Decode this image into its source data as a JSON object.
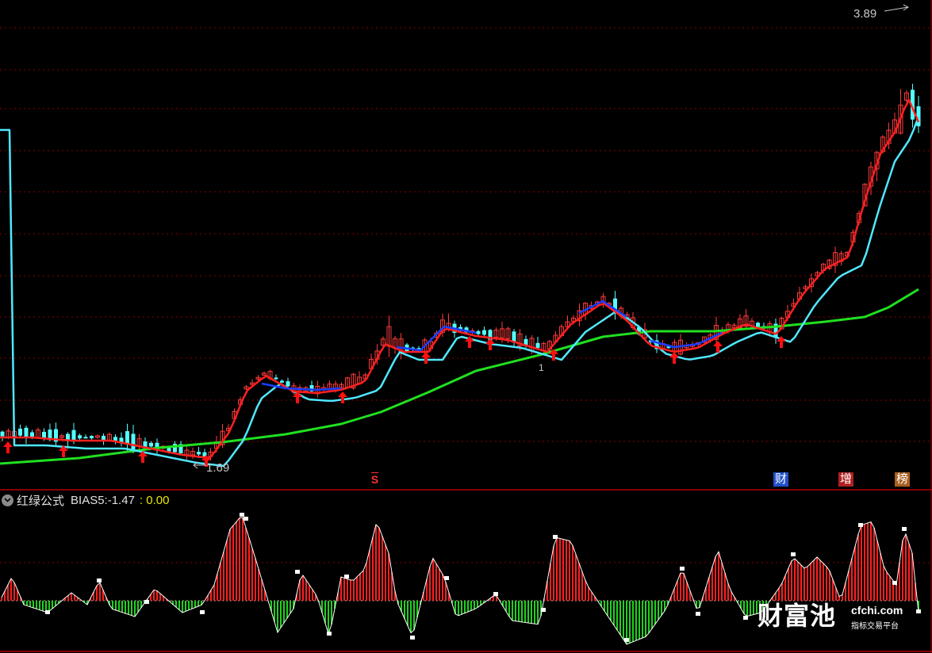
{
  "price_panel": {
    "high_label": "3.89",
    "low_label": "1.69",
    "small_label": "1",
    "markers": [
      {
        "label": "S",
        "kind": "s",
        "color": "#ff3030"
      },
      {
        "label": "财",
        "kind": "box",
        "color": "#2050c8"
      },
      {
        "label": "增",
        "kind": "box",
        "color": "#b02020"
      },
      {
        "label": "榜",
        "kind": "box",
        "color": "#a86020"
      }
    ]
  },
  "indicator": {
    "name": "红绿公式",
    "series_label": "BIAS5:",
    "series_value": "-1.47",
    "second_value": ": 0.00",
    "second_color": "#e8e800"
  },
  "watermark": {
    "logo": "财富池",
    "domain": "cfchi.com",
    "tagline": "指标交易平台"
  },
  "colors": {
    "up": "#ff3b3b",
    "down": "#54ffff",
    "ma_short": "#ff2020",
    "ma_mid": "#50e8ff",
    "ma_long": "#20e020",
    "signal_line": "#1a3cff",
    "grid": "#8a0000",
    "bias_positive": "#ff2020",
    "bias_negative": "#20d020",
    "bias_line": "#ffffff"
  }
}
